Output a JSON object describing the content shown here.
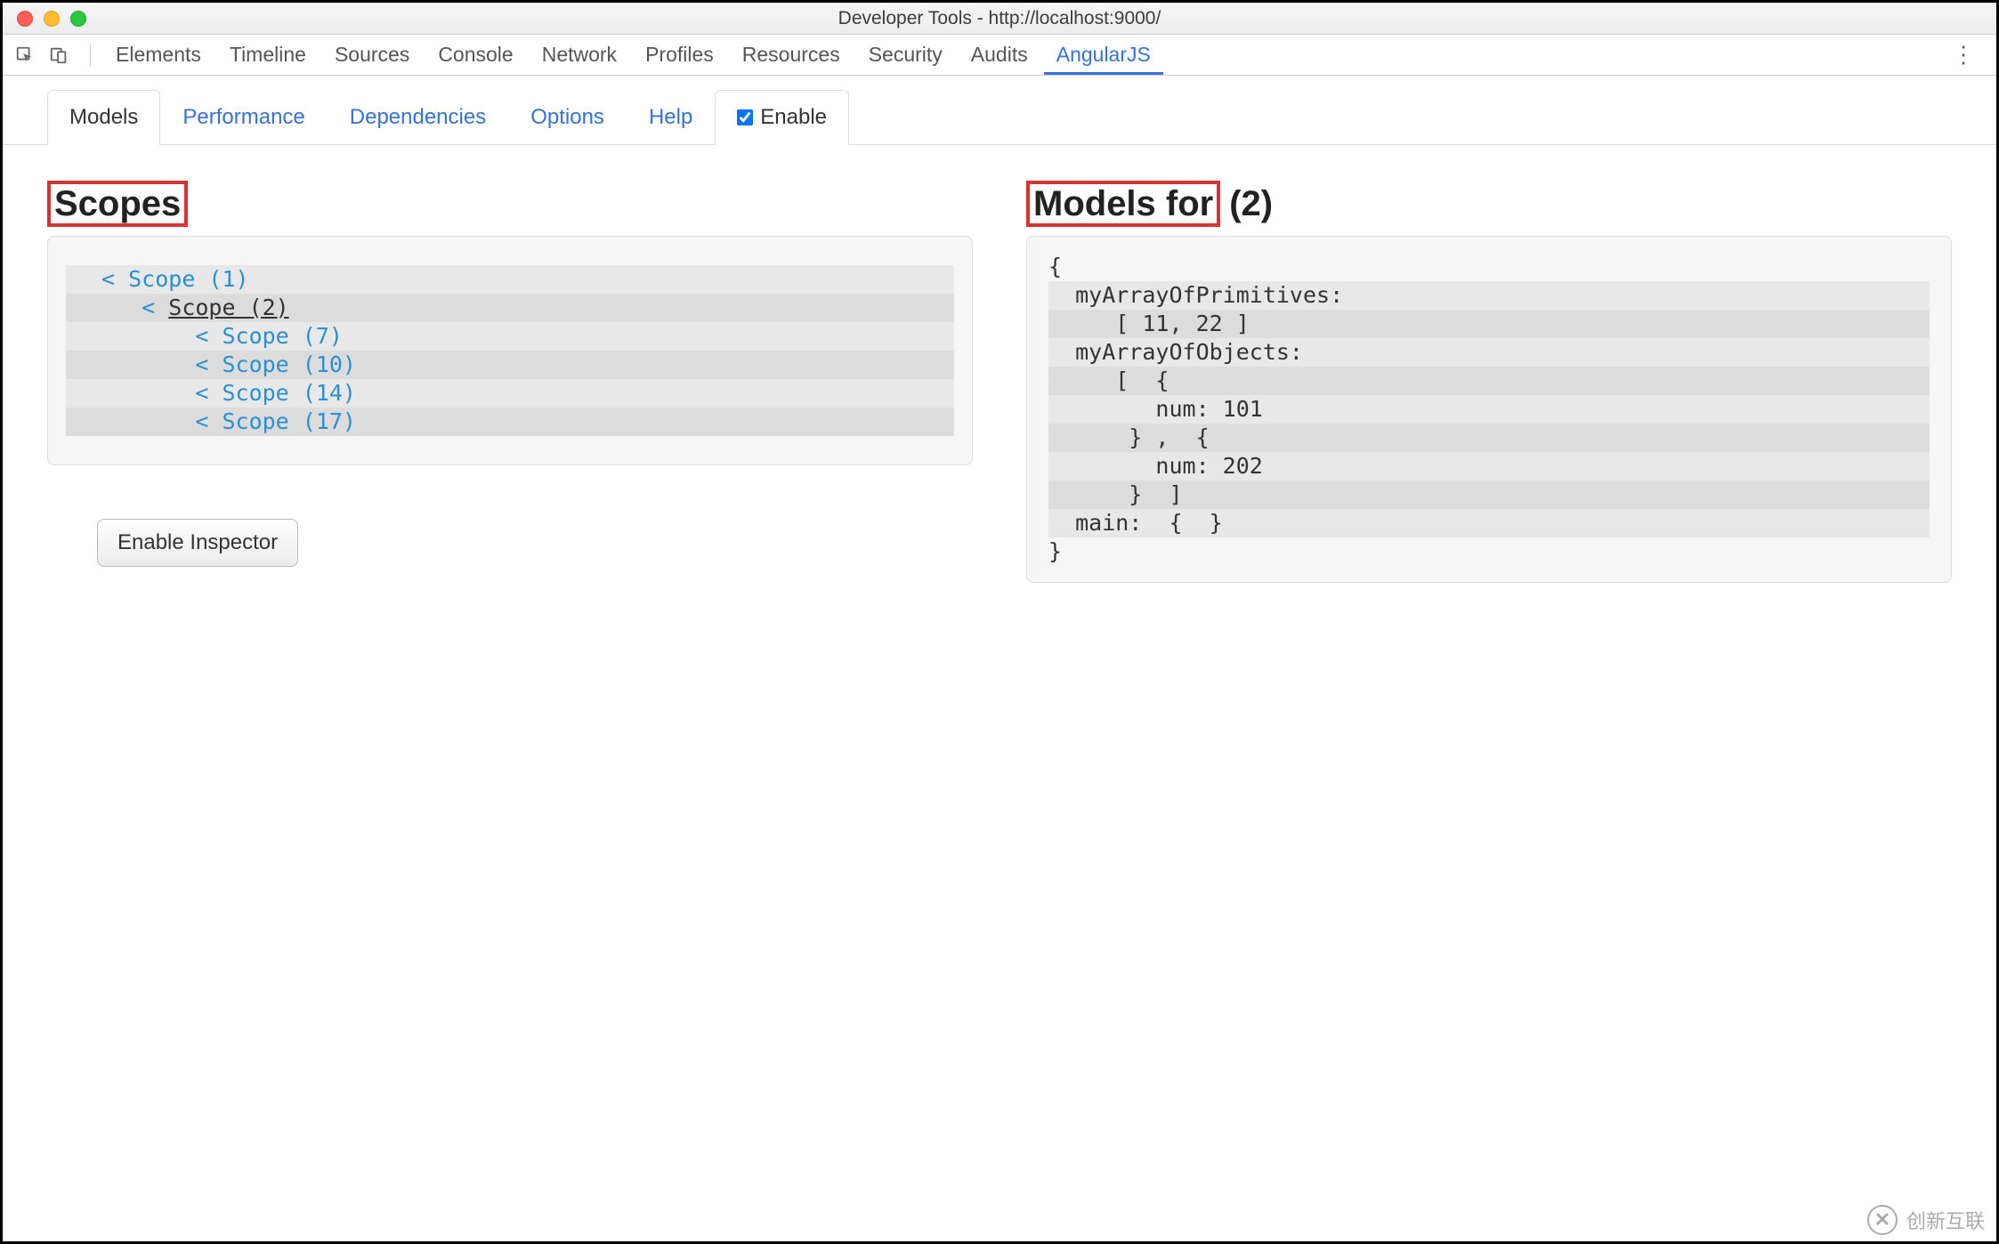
{
  "window": {
    "title": "Developer Tools - http://localhost:9000/"
  },
  "mainTabs": {
    "t0": "Elements",
    "t1": "Timeline",
    "t2": "Sources",
    "t3": "Console",
    "t4": "Network",
    "t5": "Profiles",
    "t6": "Resources",
    "t7": "Security",
    "t8": "Audits",
    "t9": "AngularJS"
  },
  "subTabs": {
    "models": "Models",
    "performance": "Performance",
    "dependencies": "Dependencies",
    "options": "Options",
    "help": "Help",
    "enable": "Enable"
  },
  "scopes": {
    "title": "Scopes",
    "s1": "Scope (1)",
    "s2": "Scope (2)",
    "s7": "Scope (7)",
    "s10": "Scope (10)",
    "s14": "Scope (14)",
    "s17": "Scope (17)"
  },
  "models": {
    "titlePrefix": "Models for",
    "titleSuffix": "(2)",
    "l0": "{",
    "l1": "  myArrayOfPrimitives:",
    "l2": "     [ 11, 22 ]",
    "l3": "  myArrayOfObjects:",
    "l4": "     [  {",
    "l5": "        num: 101",
    "l6": "      } ,  {",
    "l7": "        num: 202",
    "l8": "      }  ]",
    "l9": "  main:  {  }",
    "l10": "}"
  },
  "buttons": {
    "enableInspector": "Enable Inspector"
  },
  "watermark": {
    "text": "创新互联"
  }
}
